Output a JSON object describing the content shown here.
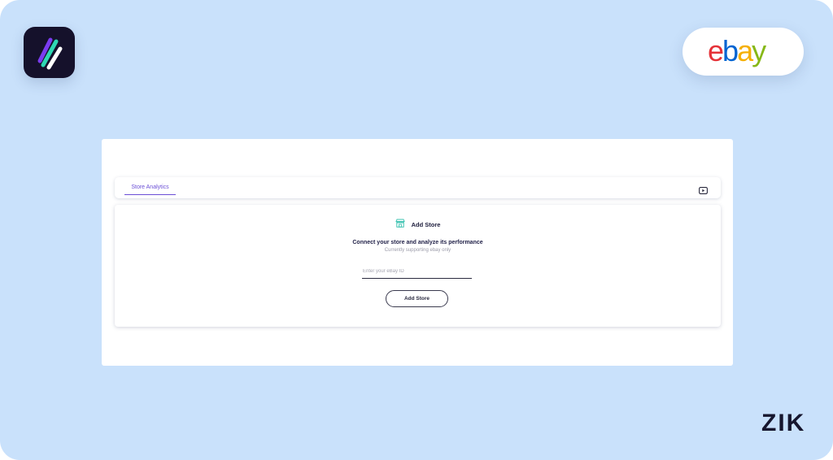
{
  "brand": {
    "app_logo_icon": "diagonal-stripes-logo-icon",
    "partner_logo_text": "ebay",
    "partner_logo_colors": [
      "#e53238",
      "#0064d2",
      "#f5af02",
      "#86b817"
    ],
    "company_mark": "ZIK"
  },
  "tabs": [
    {
      "label": "Store Analytics",
      "active": true
    }
  ],
  "toolbar": {
    "video_icon": "play-video-icon"
  },
  "add_store": {
    "icon": "store-icon",
    "title": "Add Store",
    "description": "Connect your store and analyze its performance",
    "subtitle": "Currently supporting ebay only",
    "input_placeholder": "Enter your eBay ID",
    "input_value": "",
    "button_label": "Add Store"
  },
  "colors": {
    "background": "#c9e1fb",
    "accent": "#6b4fd6",
    "store_icon": "#3fc3b2",
    "dark_text": "#1b1b3a"
  }
}
